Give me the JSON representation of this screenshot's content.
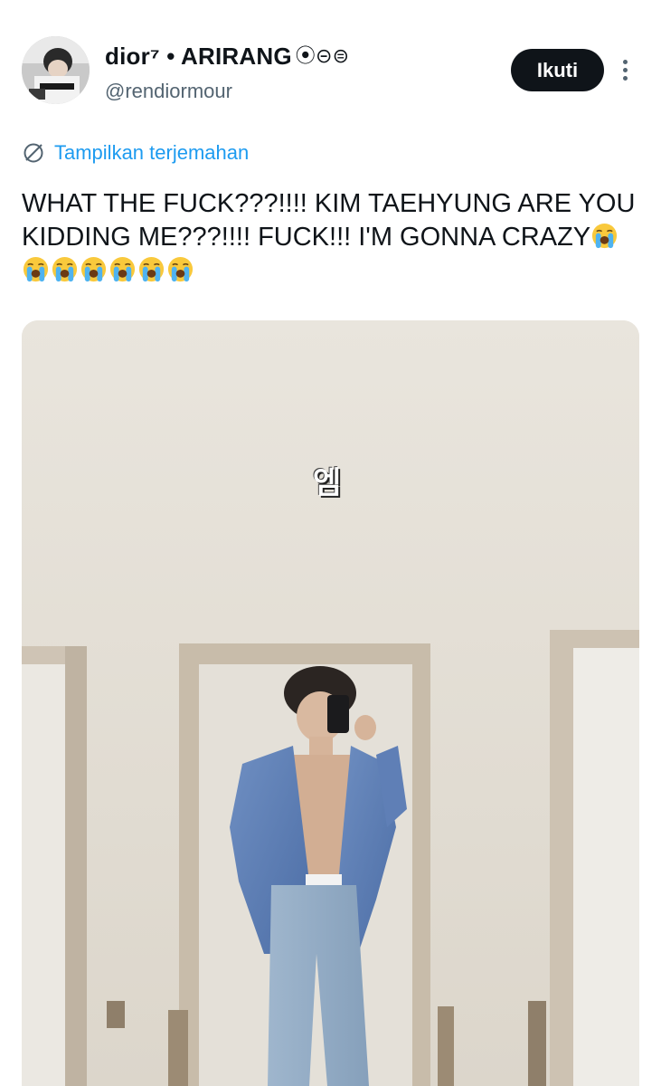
{
  "author": {
    "display_name": "dior⁷ • ARIRANG",
    "badge": "⦿⊝⊜",
    "handle": "@rendiormour",
    "avatar_icon": "avatar-photo"
  },
  "actions": {
    "follow_label": "Ikuti",
    "more_icon": "more-vertical-icon"
  },
  "translate": {
    "label": "Tampilkan terjemahan",
    "icon": "translate-globe-icon"
  },
  "tweet": {
    "text": "WHAT THE FUCK???!!!! KIM TAEHYUNG ARE YOU KIDDING ME???!!!! FUCK!!! I'M GONNA CRAZY",
    "emoji_name": "loudly-crying-face",
    "emoji_count": 7
  },
  "media": {
    "sticker_text": "엠"
  },
  "colors": {
    "accent": "#1d9bf0",
    "text": "#0f1419",
    "muted": "#536471",
    "button_bg": "#0f1419"
  }
}
